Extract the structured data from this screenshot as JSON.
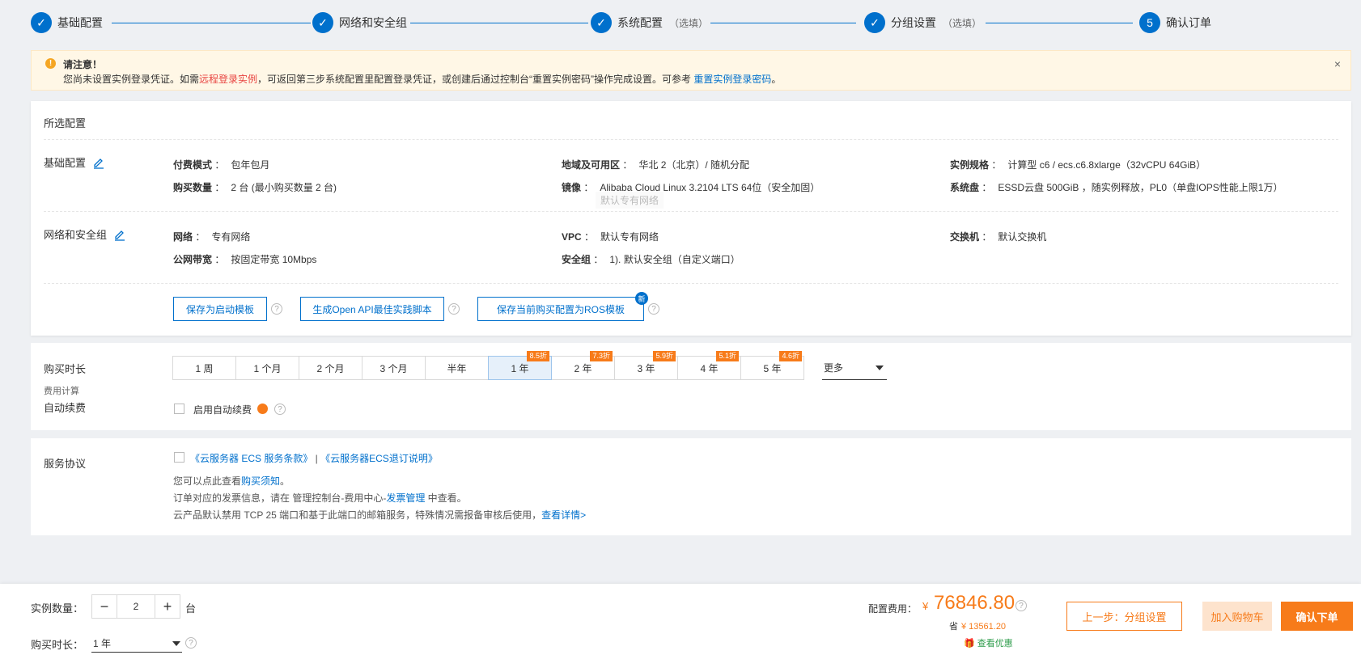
{
  "steps": [
    {
      "num": "✓",
      "label": "基础配置",
      "optional": ""
    },
    {
      "num": "✓",
      "label": "网络和安全组",
      "optional": ""
    },
    {
      "num": "✓",
      "label": "系统配置",
      "optional": "（选填）"
    },
    {
      "num": "✓",
      "label": "分组设置",
      "optional": "（选填）"
    },
    {
      "num": "5",
      "label": "确认订单",
      "optional": ""
    }
  ],
  "notice": {
    "icon": "!",
    "title": "请注意！",
    "text_a": "您尚未设置实例登录凭证。如需",
    "link_remote": "远程登录实例",
    "text_b": "，可返回第三步系统配置里配置登录凭证，或创建后通过控制台“重置实例密码”操作完成设置。可参考 ",
    "link_reset": "重置实例登录密码",
    "text_c": "。",
    "close": "×"
  },
  "config": {
    "title": "所选配置",
    "basic": {
      "label": "基础配置",
      "fields": [
        {
          "k": "付费模式",
          "v": "包年包月"
        },
        {
          "k": "地域及可用区",
          "v": "华北 2（北京）/ 随机分配"
        },
        {
          "k": "实例规格",
          "v": "计算型 c6 / ecs.c6.8xlarge（32vCPU 64GiB）"
        },
        {
          "k": "购买数量",
          "v": "2 台 (最小购买数量 2 台)"
        },
        {
          "k": "镜像",
          "v": "Alibaba Cloud Linux 3.2104 LTS 64位（安全加固）"
        },
        {
          "k": "系统盘",
          "v": "ESSD云盘 500GiB ，随实例释放，PL0（单盘IOPS性能上限1万）"
        }
      ]
    },
    "ghost_tooltip": "默认专有网络",
    "network": {
      "label": "网络和安全组",
      "fields": [
        {
          "k": "网络",
          "v": "专有网络"
        },
        {
          "k": "VPC",
          "v": "默认专有网络"
        },
        {
          "k": "交换机",
          "v": "默认交换机"
        },
        {
          "k": "公网带宽",
          "v": "按固定带宽 10Mbps"
        },
        {
          "k": "安全组",
          "v": "1). 默认安全组（自定义端口）"
        }
      ]
    },
    "buttons": {
      "save_template": "保存为启动模板",
      "gen_api": "生成Open API最佳实践脚本",
      "save_ros": "保存当前购买配置为ROS模板",
      "new_badge": "新"
    },
    "colon": "："
  },
  "duration": {
    "title": "购买时长",
    "fee_calc": "费用计算",
    "auto_renew_title": "自动续费",
    "options": [
      {
        "label": "1 周",
        "discount": ""
      },
      {
        "label": "1 个月",
        "discount": ""
      },
      {
        "label": "2 个月",
        "discount": ""
      },
      {
        "label": "3 个月",
        "discount": ""
      },
      {
        "label": "半年",
        "discount": ""
      },
      {
        "label": "1 年",
        "discount": "8.5折"
      },
      {
        "label": "2 年",
        "discount": "7.3折"
      },
      {
        "label": "3 年",
        "discount": "5.9折"
      },
      {
        "label": "4 年",
        "discount": "5.1折"
      },
      {
        "label": "5 年",
        "discount": "4.6折"
      }
    ],
    "selected": "1 年",
    "more": "更多",
    "auto_renew_label": "启用自动续费"
  },
  "service": {
    "title": "服务协议",
    "terms1": "《云服务器 ECS 服务条款》",
    "sep": " | ",
    "terms2": "《云服务器ECS退订说明》",
    "line1_a": "您可以点此查看",
    "line1_link": "购买须知",
    "line1_b": "。",
    "line2_a": "订单对应的发票信息，请在 管理控制台-费用中心-",
    "line2_link": "发票管理",
    "line2_b": " 中查看。",
    "line3_a": "云产品默认禁用 TCP 25 端口和基于此端口的邮箱服务，特殊情况需报备审核后使用，",
    "line3_link": "查看详情>"
  },
  "footer": {
    "qty_label": "实例数量：",
    "qty_minus": "−",
    "qty_value": "2",
    "qty_plus": "+",
    "qty_unit": "台",
    "dur_label": "购买时长：",
    "dur_value": "1 年",
    "price_label": "配置费用：",
    "currency": "¥",
    "price": "76846.80",
    "save_label": "省",
    "save_amount": "¥ 13561.20",
    "promo": "🎁 查看优惠",
    "prev_btn": "上一步：分组设置",
    "cart_btn": "加入购物车",
    "order_btn": "确认下单"
  },
  "help_glyph": "?"
}
